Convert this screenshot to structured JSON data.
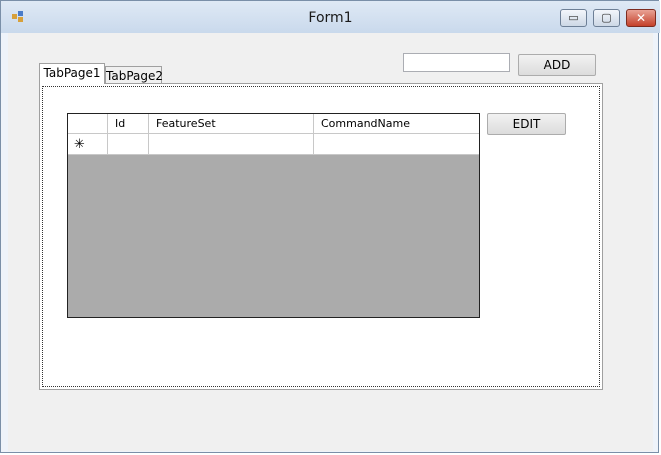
{
  "window": {
    "title": "Form1"
  },
  "titlebar_buttons": {
    "minimize": "▭",
    "maximize": "▢",
    "close": "✕"
  },
  "toolbar": {
    "add_input_value": "",
    "add_label": "ADD",
    "edit_label": "EDIT"
  },
  "tabs": [
    {
      "label": "TabPage1",
      "selected": true
    },
    {
      "label": "TabPage2",
      "selected": false
    }
  ],
  "grid": {
    "columns": [
      "Id",
      "FeatureSet",
      "CommandName"
    ],
    "new_row_marker": "✳",
    "rows": [
      [
        "",
        "",
        ""
      ]
    ]
  },
  "colors": {
    "grid_background": "#ababab",
    "titlebar": "#c9d9ec"
  }
}
